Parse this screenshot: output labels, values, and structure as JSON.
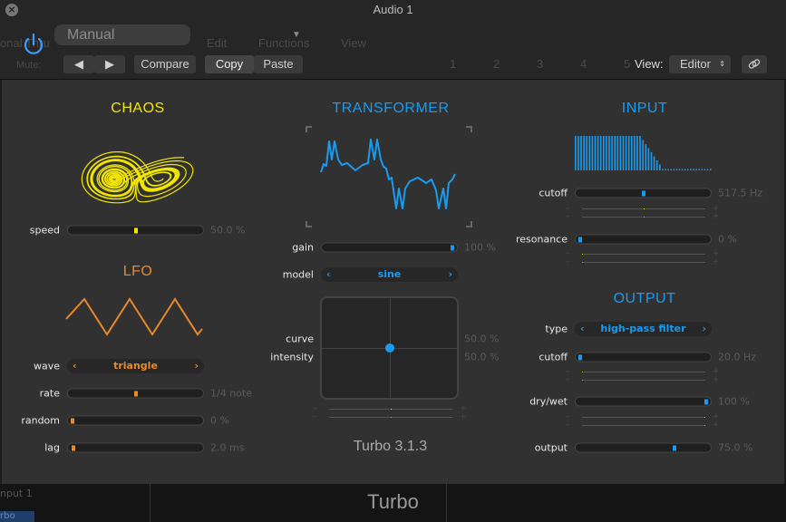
{
  "window": {
    "title": "Audio 1"
  },
  "background": {
    "edit": "Edit",
    "functions": "Functions",
    "view": "View",
    "mute": "Mute:",
    "thru": "onal Thru",
    "ruler": [
      "1",
      "2",
      "3",
      "4",
      "5"
    ],
    "input": "nput 1",
    "track": "rbo"
  },
  "header": {
    "preset": "Manual",
    "compare": "Compare",
    "copy": "Copy",
    "paste": "Paste",
    "view_label": "View:",
    "view_value": "Editor"
  },
  "colors": {
    "chaos": "#f2e600",
    "lfo": "#e8892a",
    "blue": "#1a9bf0",
    "panel": "#313131"
  },
  "chaos": {
    "title": "CHAOS",
    "speed": {
      "label": "speed",
      "value": "50.0 %",
      "fraction": 0.5
    }
  },
  "lfo": {
    "title": "LFO",
    "wave": {
      "label": "wave",
      "value": "triangle"
    },
    "rate": {
      "label": "rate",
      "value": "1/4 note",
      "fraction": 0.5
    },
    "random": {
      "label": "random",
      "value": "0 %",
      "fraction": 0
    },
    "lag": {
      "label": "lag",
      "value": "2.0 ms",
      "fraction": 0.01
    }
  },
  "transformer": {
    "title": "TRANSFORMER",
    "gain": {
      "label": "gain",
      "value": "100 %",
      "fraction": 1
    },
    "model": {
      "label": "model",
      "value": "sine"
    },
    "curve": {
      "label": "curve",
      "value": "50.0 %",
      "fraction": 0.5
    },
    "intensity": {
      "label": "intensity",
      "value": "50.0 %",
      "fraction": 0.5
    },
    "version": "Turbo 3.1.3"
  },
  "input": {
    "title": "INPUT",
    "cutoff": {
      "label": "cutoff",
      "value": "517.5 Hz",
      "fraction": 0.5
    },
    "resonance": {
      "label": "resonance",
      "value": "0 %",
      "fraction": 0
    }
  },
  "output": {
    "title": "OUTPUT",
    "type": {
      "label": "type",
      "value": "high-pass filter"
    },
    "cutoff": {
      "label": "cutoff",
      "value": "20.0 Hz",
      "fraction": 0
    },
    "drywet": {
      "label": "dry/wet",
      "value": "100 %",
      "fraction": 1
    },
    "output": {
      "label": "output",
      "value": "75.0 %",
      "fraction": 0.75
    }
  },
  "footer": {
    "name": "Turbo"
  }
}
